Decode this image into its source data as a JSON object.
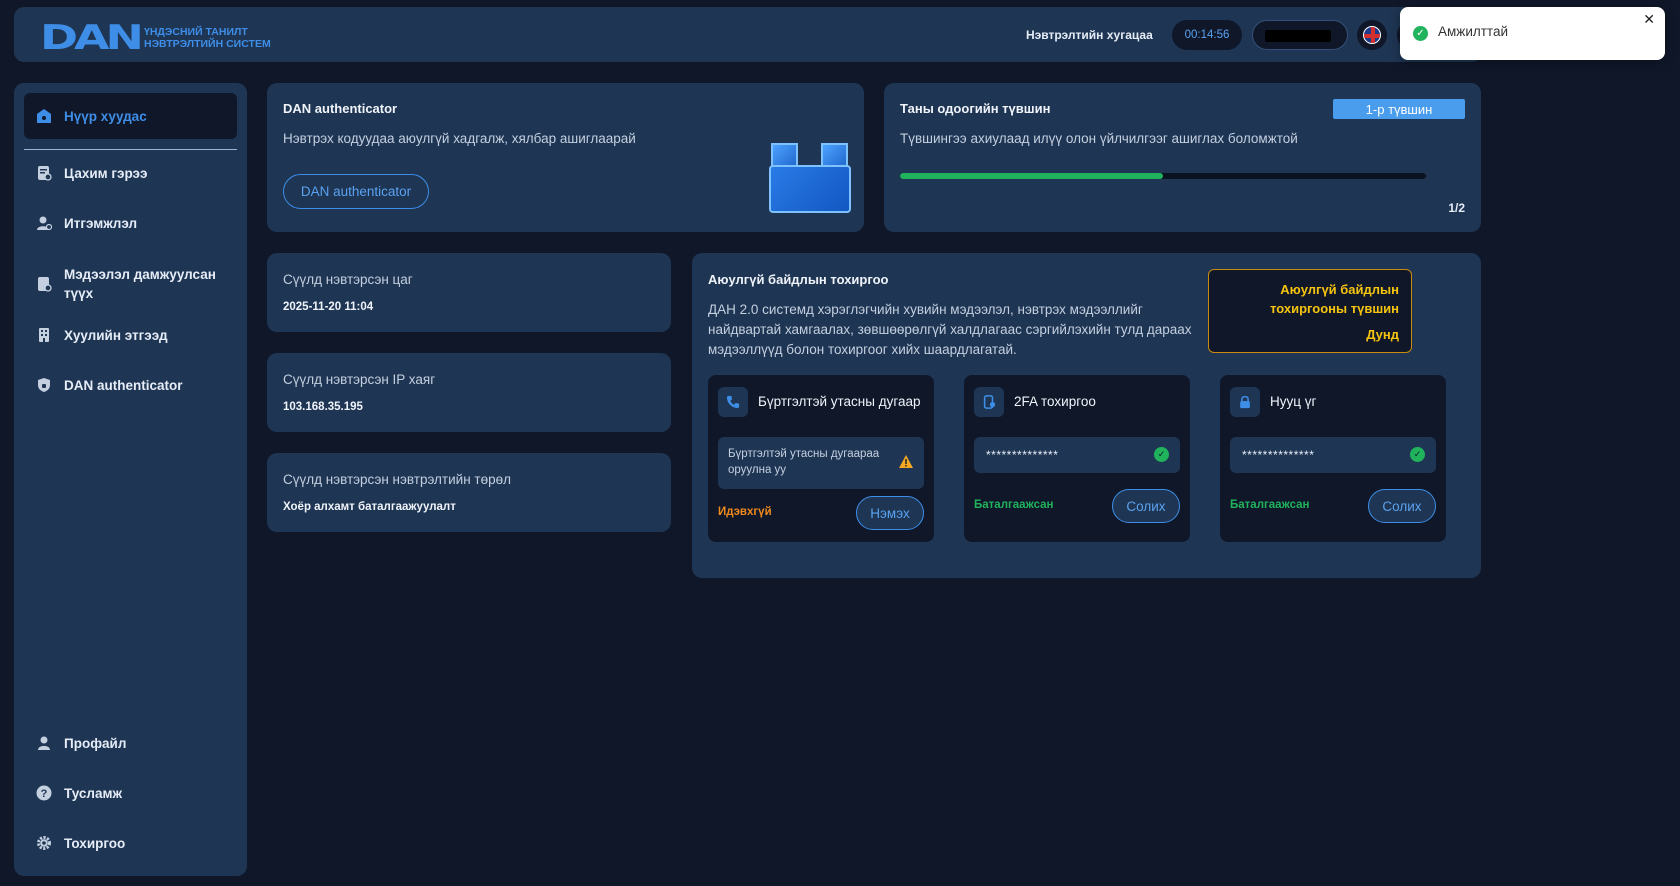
{
  "header": {
    "logo_mark": "DAN",
    "logo_line1": "ҮНДЭСНИЙ ТАНИЛТ",
    "logo_line2": "НЭВТРЭЛТИЙН СИСТЕМ",
    "session_label": "Нэвтрэлтийн хугацаа",
    "session_timer": "00:14:56"
  },
  "toast": {
    "message": "Амжилттай",
    "close": "✕"
  },
  "sidebar": {
    "items": [
      {
        "label": "Нүүр хуудас",
        "icon": "home-icon"
      },
      {
        "label": "Цахим гэрээ",
        "icon": "contract-icon"
      },
      {
        "label": "Итгэмжлэл",
        "icon": "proxy-user-icon"
      },
      {
        "label": "Мэдээлэл дамжуулсан түүх",
        "icon": "history-icon"
      },
      {
        "label": "Хуулийн этгээд",
        "icon": "building-icon"
      },
      {
        "label": "DAN authenticator",
        "icon": "shield-icon"
      }
    ],
    "bottom": [
      {
        "label": "Профайл",
        "icon": "user-icon"
      },
      {
        "label": "Тусламж",
        "icon": "help-icon"
      },
      {
        "label": "Тохиргоо",
        "icon": "gear-icon"
      }
    ]
  },
  "auth_card": {
    "title": "DAN authenticator",
    "subtitle": "Нэвтрэх кодуудаа аюулгүй хадгалж, хялбар ашиглаарай",
    "button": "DAN authenticator"
  },
  "level_card": {
    "title": "Таны одоогийн түвшин",
    "badge": "1-р түвшин",
    "subtitle": "Түвшингээ ахиулаад илүү олон үйлчилгээг ашиглах боломжтой",
    "progress_fraction": 0.5,
    "progress_text": "1/2",
    "colors": {
      "fill": "#21b35c",
      "badge": "#4a9cec"
    }
  },
  "last_login": {
    "time_label": "Сүүлд нэвтэрсэн цаг",
    "time_value": "2025-11-20 11:04",
    "ip_label": "Сүүлд нэвтэрсэн IP хаяг",
    "ip_value": "103.168.35.195",
    "type_label": "Сүүлд нэвтэрсэн нэвтрэлтийн төрөл",
    "type_value": "Хоёр алхамт баталгаажуулалт"
  },
  "security": {
    "title": "Аюулгүй байдлын тохиргоо",
    "description": "ДАН 2.0 системд хэрэглэгчийн хувийн мэдээлэл, нэвтрэх мэдээллийг найдвартай хамгаалах, зөвшөөрөлгүй халдлагаас сэргийлэхийн тулд дараах мэдээллүүд болон тохиргоог хийх шаардлагатай.",
    "level_line1": "Аюулгүй байдлын",
    "level_line2": "тохиргооны түвшин",
    "level_value": "Дунд",
    "phone": {
      "title": "Бүртгэлтэй утасны дугаар",
      "field": "Бүртгэлтэй утасны дугаараа оруулна уу",
      "status": "Идэвхгүй",
      "button": "Нэмэх"
    },
    "twofa": {
      "title": "2FA тохиргоо",
      "field": "**************",
      "status": "Баталгаажсан",
      "button": "Солих"
    },
    "password": {
      "title": "Нууц үг",
      "field": "**************",
      "status": "Баталгаажсан",
      "button": "Солих"
    }
  }
}
